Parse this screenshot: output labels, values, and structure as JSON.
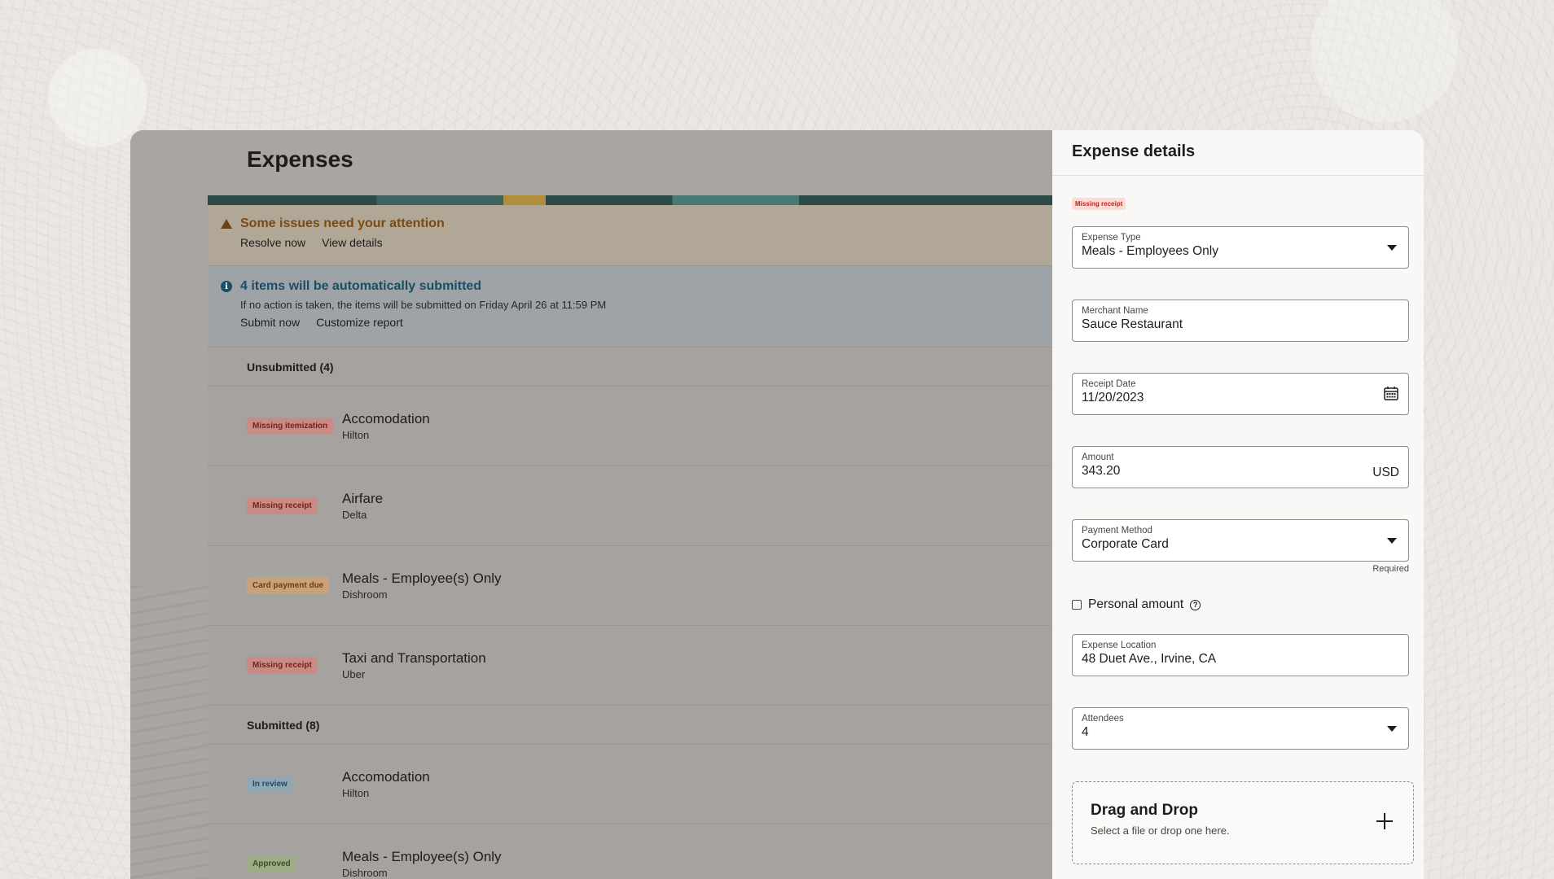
{
  "page": {
    "title": "Expenses"
  },
  "alerts": {
    "warning": {
      "title": "Some issues need your attention",
      "actions": [
        "Resolve now",
        "View details"
      ]
    },
    "info": {
      "title": "4 items will be automatically submitted",
      "description": "If no action is taken, the items will be submitted on Friday April 26 at 11:59 PM",
      "actions": [
        "Submit now",
        "Customize report"
      ]
    }
  },
  "unsubmitted": {
    "heading": "Unsubmitted (4)",
    "items": [
      {
        "badge": "Missing itemization",
        "title": "Accomodation",
        "merchant": "Hilton"
      },
      {
        "badge": "Missing receipt",
        "title": "Airfare",
        "merchant": "Delta"
      },
      {
        "badge": "Card payment due",
        "title": "Meals - Employee(s) Only",
        "merchant": "Dishroom"
      },
      {
        "badge": "Missing receipt",
        "title": "Taxi and Transportation",
        "merchant": "Uber"
      }
    ]
  },
  "submitted": {
    "heading": "Submitted (8)",
    "items": [
      {
        "badge": "In review",
        "title": "Accomodation",
        "merchant": "Hilton"
      },
      {
        "badge": "Approved",
        "title": "Meals - Employee(s) Only",
        "merchant": "Dishroom"
      }
    ]
  },
  "drawer": {
    "title": "Expense details",
    "badge": "Missing receipt",
    "expense_type": {
      "label": "Expense Type",
      "value": "Meals - Employees Only"
    },
    "merchant_name": {
      "label": "Merchant Name",
      "value": "Sauce Restaurant"
    },
    "receipt_date": {
      "label": "Receipt Date",
      "value": "11/20/2023"
    },
    "amount": {
      "label": "Amount",
      "value": "343.20",
      "currency": "USD"
    },
    "payment_method": {
      "label": "Payment Method",
      "value": "Corporate Card",
      "helper": "Required"
    },
    "personal_amount": {
      "label": "Personal amount",
      "checked": false
    },
    "expense_location": {
      "label": "Expense Location",
      "value": "48 Duet Ave., Irvine, CA"
    },
    "attendees": {
      "label": "Attendees",
      "value": "4"
    },
    "dropzone": {
      "title": "Drag and Drop",
      "subtitle": "Select a file or drop one here."
    }
  },
  "icons": {
    "warning": "warning-triangle-icon",
    "info": "info-icon",
    "caret": "chevron-down-icon",
    "calendar": "calendar-icon",
    "help": "help-circle-icon",
    "add": "plus-icon"
  },
  "colors": {
    "danger_badge_bg": "#ffd9d4",
    "danger_badge_text": "#b42c1f",
    "warning_title": "#7a4a15",
    "info_title": "#1c4d66"
  }
}
